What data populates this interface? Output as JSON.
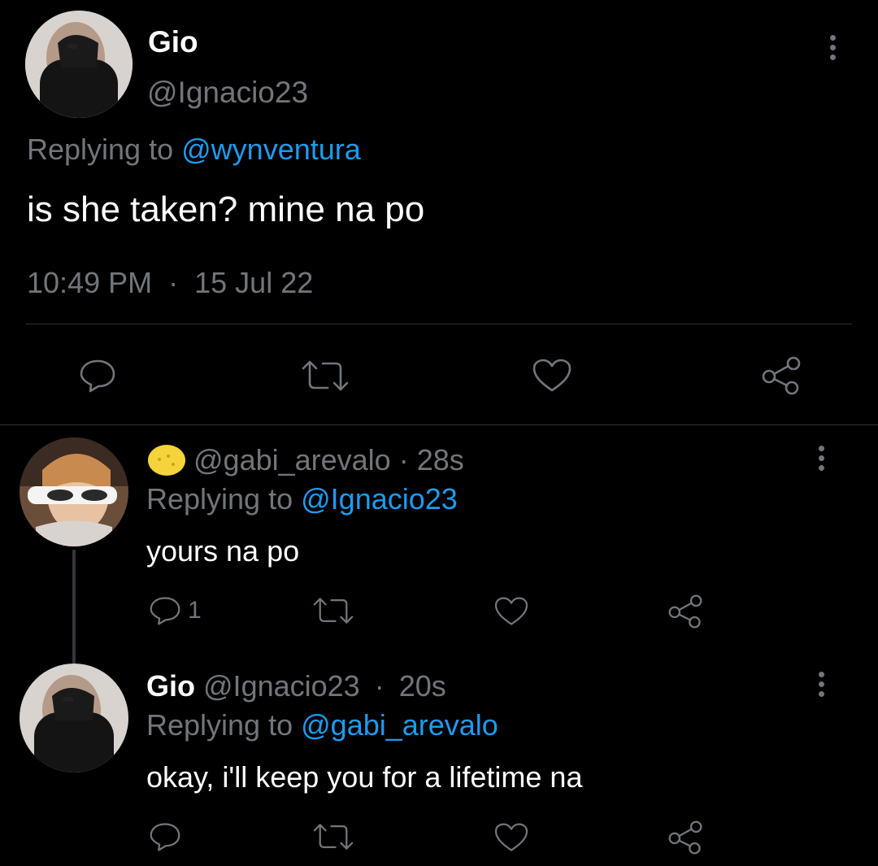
{
  "main_tweet": {
    "display_name": "Gio",
    "handle": "@Ignacio23",
    "replying_prefix": "Replying to",
    "replying_to": "@wynventura",
    "text": "is she taken? mine na po",
    "time": "10:49 PM",
    "separator": "·",
    "date": "15 Jul 22"
  },
  "replies": [
    {
      "emoji_icon": "yellow-face-icon",
      "display_name": "",
      "handle": "@gabi_arevalo",
      "separator": "·",
      "age": "28s",
      "replying_prefix": "Replying to",
      "replying_to": "@Ignacio23",
      "text": "yours na po",
      "reply_count": "1"
    },
    {
      "display_name": "Gio",
      "handle": "@Ignacio23",
      "separator": "·",
      "age": "20s",
      "replying_prefix": "Replying to",
      "replying_to": "@gabi_arevalo",
      "text": "okay, i'll keep you for a lifetime na",
      "reply_count": ""
    }
  ],
  "colors": {
    "background": "#000000",
    "text": "#e7e9ea",
    "secondary": "#71767b",
    "link": "#1d9bf0",
    "divider": "#2f3336"
  }
}
